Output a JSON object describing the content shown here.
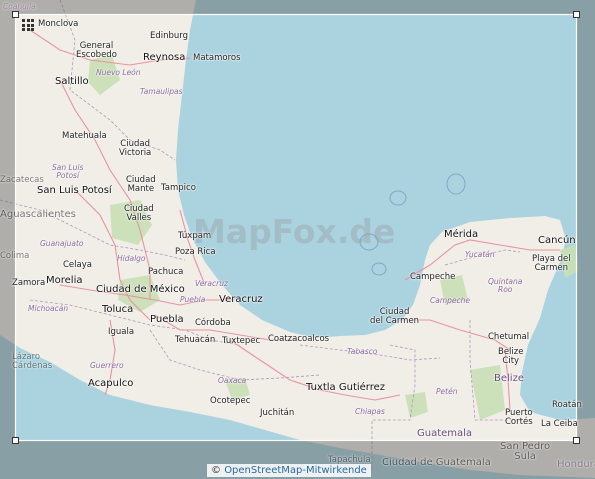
{
  "map": {
    "watermark": "MapFox.de",
    "attribution": {
      "symbol": "©",
      "link_text": "OpenStreetMap-Mitwirkende"
    },
    "colors": {
      "land": "#f1eee8",
      "water": "#aad3df",
      "vegetation": "#c8dfb4",
      "dim_overlay": "#6e6e6e",
      "selection_border": "#ffffff",
      "highway": "#e892a2",
      "boundary": "#b196b9"
    },
    "selection_tool": {
      "icon": "grid-icon",
      "handles": [
        "top-left",
        "top-right",
        "bottom-left",
        "bottom-right"
      ]
    },
    "cities": {
      "coahuila": "Coahuila",
      "monclova": "Monclova",
      "edinburg": "Edinburg",
      "general_escobedo": "General\nEscobedo",
      "reynosa": "Reynosa",
      "matamoros": "Matamoros",
      "nuevo_leon": "Nuevo León",
      "saltillo": "Saltillo",
      "tamaulipas": "Tamaulipas",
      "matehuala": "Matehuala",
      "ciudad_victoria": "Ciudad\nVictoria",
      "zacatecas": "Zacatecas",
      "san_luis_potosi_state": "San Luis\nPotosí",
      "ciudad_mante": "Ciudad\nMante",
      "san_luis_potosi": "San Luis Potosí",
      "tampico": "Tampico",
      "aguascalientes": "Aguascalientes",
      "ciudad_valles": "Ciudad\nValles",
      "guanajuato": "Guanajuato",
      "tuxpam": "Túxpam",
      "poza_rica": "Poza Rica",
      "celaya": "Celaya",
      "hidalgo": "Hidalgo",
      "pachuca": "Pachuca",
      "zamora": "Zamora",
      "morelia": "Morelia",
      "ciudad_de_mexico": "Ciudad de México",
      "veracruz_state": "Veracruz",
      "michoacan": "Michoacán",
      "puebla_state": "Puebla",
      "toluca": "Toluca",
      "veracruz": "Veracruz",
      "puebla": "Puebla",
      "cordoba": "Córdoba",
      "iguala": "Iguala",
      "tehuacan": "Tehuacán",
      "tuxtepec": "Tuxtepec",
      "coatzacoalcos": "Coatzacoalcos",
      "lazaro_cardenas": "Lázaro\nCárdenas",
      "guerrero": "Guerrero",
      "acapulco": "Acapulco",
      "oaxaca": "Oaxaca",
      "ocotepec": "Ocotepec",
      "juchitan": "Juchitán",
      "tuxtla": "Tuxtla Gutiérrez",
      "chiapas": "Chiapas",
      "tabasco": "Tabasco",
      "ciudad_del_carmen": "Ciudad\ndel Carmen",
      "campeche": "Campeche",
      "campeche_state": "Campeche",
      "merida": "Mérida",
      "yucatan": "Yucatán",
      "cancun": "Cancún",
      "playa_del_carmen": "Playa del\nCarmen",
      "quintana_roo": "Quintana\nRoo",
      "chetumal": "Chetumal",
      "belize_city": "Belize\nCity",
      "belize": "Belize",
      "peten": "Petén",
      "guatemala": "Guatemala",
      "puerto_cortes": "Puerto\nCortés",
      "roatan": "Roatán",
      "la_ceiba": "La Ceiba",
      "san_pedro": "San Pedro\nSula",
      "ciudad_de_guatemala": "Ciudad de Guatemala",
      "tapachula": "Tapachula",
      "honduras": "Honduras",
      "colima": "Colima"
    }
  }
}
